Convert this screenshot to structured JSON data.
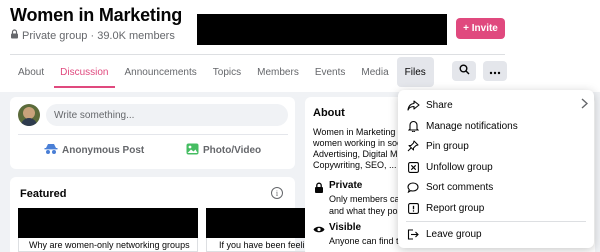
{
  "group": {
    "title": "Women in Marketing",
    "privacy": "Private group · 39.0K members",
    "invite_label": "+ Invite"
  },
  "tabs": [
    "About",
    "Discussion",
    "Announcements",
    "Topics",
    "Members",
    "Events",
    "Media",
    "Files"
  ],
  "composer": {
    "placeholder": "Write something...",
    "anonymous_label": "Anonymous Post",
    "photo_label": "Photo/Video"
  },
  "featured": {
    "title": "Featured",
    "items": [
      "Why are women-only networking groups",
      "If you have been feeli"
    ]
  },
  "about": {
    "title": "About",
    "description": [
      "Women in Marketing i",
      "women working in soc",
      "Advertising, Digital M",
      "Copywriting, SEO, ... S"
    ],
    "private_title": "Private",
    "private_desc": [
      "Only members can",
      "and what they pos"
    ],
    "visible_title": "Visible",
    "visible_desc": "Anyone can find t"
  },
  "menu": {
    "items": [
      "Share",
      "Manage notifications",
      "Pin group",
      "Unfollow group",
      "Sort comments",
      "Report group",
      "Leave group"
    ]
  },
  "colors": {
    "accent": "#e0497e",
    "muted": "#65676b",
    "bg": "#f0f2f5"
  }
}
